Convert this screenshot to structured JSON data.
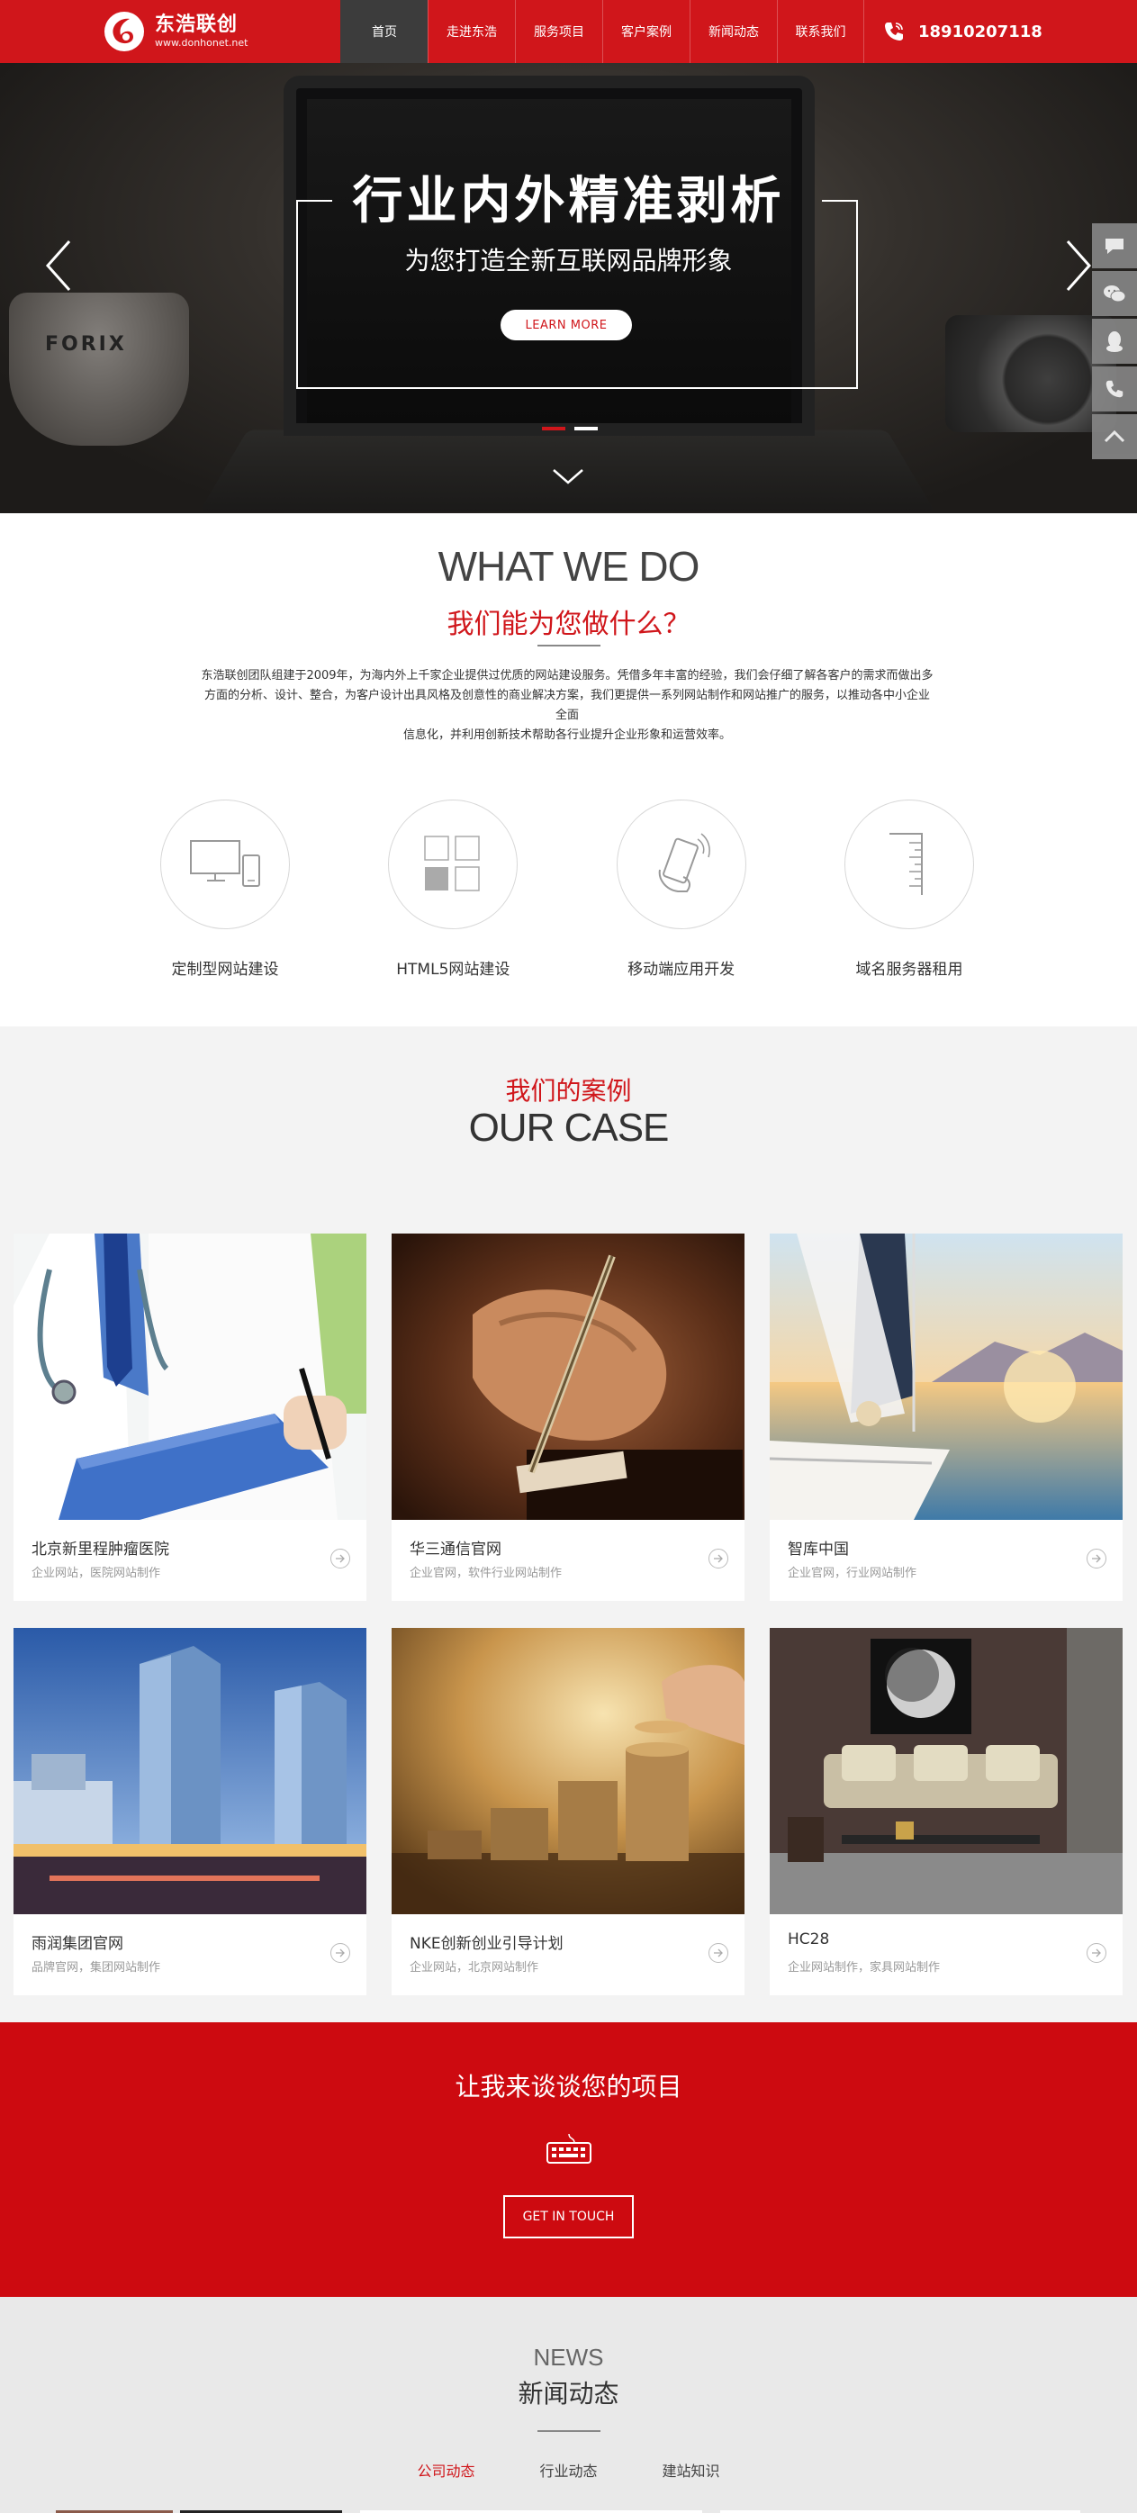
{
  "header": {
    "logo_name": "东浩联创",
    "logo_url": "www.donhonet.net",
    "nav": [
      "首页",
      "走进东浩",
      "服务项目",
      "客户案例",
      "新闻动态",
      "联系我们"
    ],
    "phone": "18910207118"
  },
  "hero": {
    "title": "行业内外精准剥析",
    "subtitle": "为您打造全新互联网品牌形象",
    "button": "LEARN MORE",
    "cup_text": "FORIX"
  },
  "intro": {
    "title_en": "WHAT WE DO",
    "title_cn": "我们能为您做什么？",
    "desc_1": "东浩联创团队组建于2009年，为海内外上千家企业提供过优质的网站建设服务。凭借多年丰富的经验，我们会仔细了解各客户的需求而做出多",
    "desc_2": "方面的分析、设计、整合，为客户设计出具风格及创意性的商业解决方案，我们更提供一系列网站制作和网站推广的服务，以推动各中小企业",
    "desc_3": "全面",
    "desc_4": "信息化，并利用创新技术帮助各行业提升企业形象和运营效率。",
    "services": [
      {
        "label": "定制型网站建设",
        "icon": "monitor-devices-icon"
      },
      {
        "label": "HTML5网站建设",
        "icon": "grid-blocks-icon"
      },
      {
        "label": "移动端应用开发",
        "icon": "hand-phone-icon"
      },
      {
        "label": "域名服务器租用",
        "icon": "server-ruler-icon"
      }
    ]
  },
  "cases": {
    "title_cn": "我们的案例",
    "title_en": "OUR CASE",
    "items": [
      {
        "name": "北京新里程肿瘤医院",
        "tags": "企业网站，医院网站制作",
        "image": "doctor-clipboard"
      },
      {
        "name": "华三通信官网",
        "tags": "企业官网，软件行业网站制作",
        "image": "hand-writing-pen"
      },
      {
        "name": "智库中国",
        "tags": "企业官网，行业网站制作",
        "image": "sailboat-sunset"
      },
      {
        "name": "雨润集团官网",
        "tags": "品牌官网，集团网站制作",
        "image": "glass-skyscrapers"
      },
      {
        "name": "NKE创新创业引导计划",
        "tags": "企业网站，北京网站制作",
        "image": "coin-stacks"
      },
      {
        "name": "HC28",
        "tags": "企业网站制作，家具网站制作",
        "image": "living-room-sofa"
      }
    ]
  },
  "cta": {
    "title": "让我来谈谈您的项目",
    "button": "GET IN TOUCH"
  },
  "news": {
    "title_en": "NEWS",
    "title_cn": "新闻动态",
    "tabs": [
      "公司动态",
      "行业动态",
      "建站知识"
    ]
  },
  "colors": {
    "brand_red": "#d0161b",
    "cta_red": "#cd0a10",
    "nav_active": "#3c3c3c"
  }
}
